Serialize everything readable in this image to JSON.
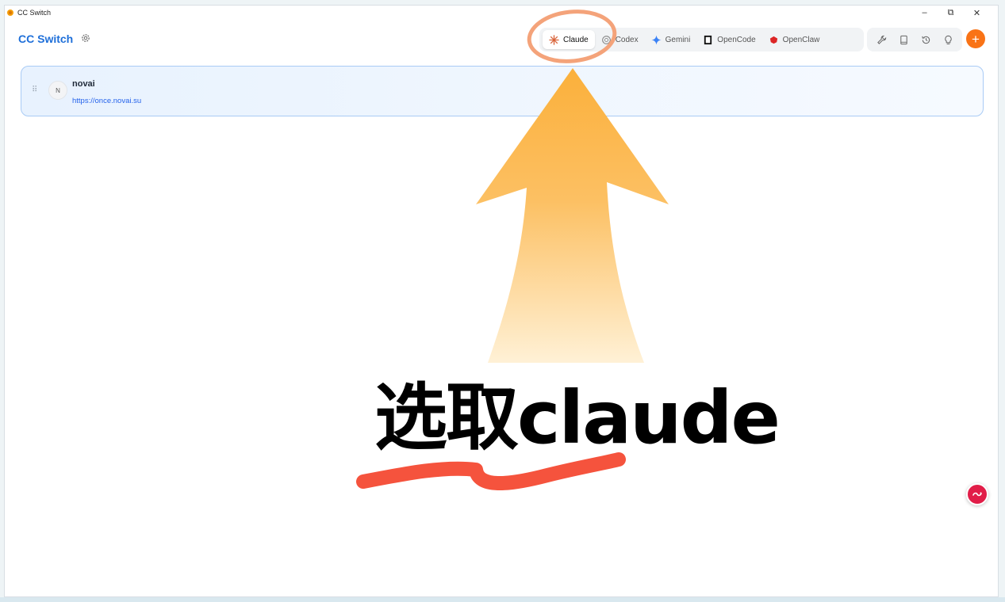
{
  "window": {
    "title": "CC Switch",
    "controls": {
      "minimize": "–",
      "restore": "⧉",
      "close": "✕"
    }
  },
  "header": {
    "brand": "CC Switch",
    "tabs": [
      {
        "label": "Claude",
        "icon": "claude-icon",
        "active": true
      },
      {
        "label": "Codex",
        "icon": "codex-icon",
        "active": false
      },
      {
        "label": "Gemini",
        "icon": "gemini-icon",
        "active": false
      },
      {
        "label": "OpenCode",
        "icon": "opencode-icon",
        "active": false
      },
      {
        "label": "OpenClaw",
        "icon": "openclaw-icon",
        "active": false
      }
    ],
    "tools": [
      "wrench-icon",
      "book-icon",
      "history-icon",
      "lightbulb-icon"
    ],
    "add_label": "+"
  },
  "providers": [
    {
      "avatar": "N",
      "name": "novai",
      "url": "https://once.novai.su"
    }
  ],
  "annotation": {
    "caption": "选取claude",
    "colors": {
      "arrow": "#fbb03b",
      "circle": "#f4a37a",
      "underline": "#f5533d"
    }
  },
  "colors": {
    "brand": "#1e6fd9",
    "accent": "#f97316",
    "card_border": "#a9cbf5"
  }
}
